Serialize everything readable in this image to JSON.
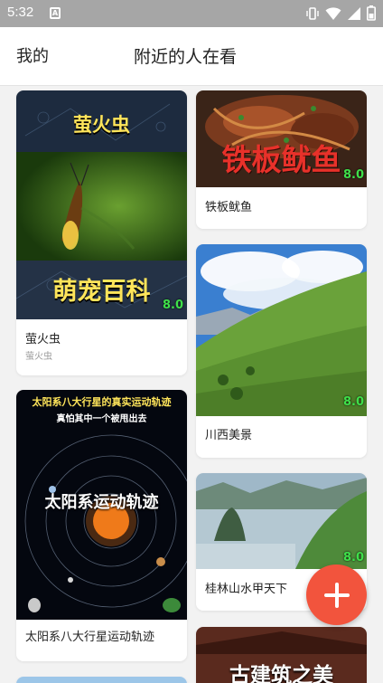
{
  "status": {
    "time": "5:32",
    "notification_icon": "A"
  },
  "header": {
    "mine": "我的",
    "title": "附近的人在看"
  },
  "cards": [
    {
      "title": "萤火虫",
      "subtitle": "萤火虫",
      "overlay_top": "萤火虫",
      "overlay_bottom": "萌宠百科",
      "score": "8.0"
    },
    {
      "title": "铁板鱿鱼",
      "overlay": "铁板鱿鱼",
      "score": "8.0"
    },
    {
      "title": "川西美景",
      "score": "8.0"
    },
    {
      "title": "太阳系八大行星运动轨迹",
      "overlay_line1": "太阳系八大行星的真实运动轨迹",
      "overlay_line2": "真怕其中一个被甩出去",
      "overlay_center": "太阳系运动轨迹"
    },
    {
      "title": "桂林山水甲天下",
      "score": "8.0"
    },
    {
      "overlay": "古建筑之美"
    }
  ],
  "fab": {
    "icon": "plus-icon",
    "color": "#f2543d"
  }
}
